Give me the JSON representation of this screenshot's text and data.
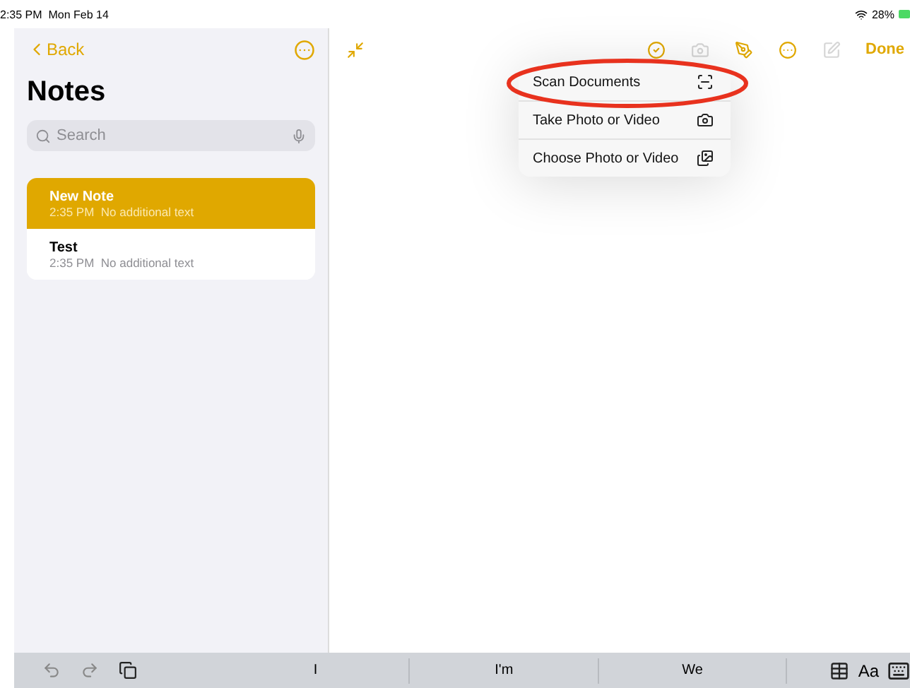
{
  "status_bar": {
    "time": "2:35 PM",
    "date": "Mon Feb 14",
    "battery": "28%"
  },
  "sidebar": {
    "back": "Back",
    "title": "Notes",
    "search": {
      "placeholder": "Search"
    },
    "notes": [
      {
        "title": "New Note",
        "time": "2:35 PM",
        "preview": "No additional text",
        "selected": true
      },
      {
        "title": "Test",
        "time": "2:35 PM",
        "preview": "No additional text",
        "selected": false
      }
    ]
  },
  "toolbar": {
    "items": [
      {
        "kind": "checklist",
        "disabled": false
      },
      {
        "kind": "camera",
        "disabled": true
      },
      {
        "kind": "markup",
        "disabled": false
      },
      {
        "kind": "more",
        "disabled": false
      },
      {
        "kind": "compose",
        "disabled": true
      }
    ],
    "done": "Done"
  },
  "menu": {
    "items": [
      {
        "label": "Scan Documents",
        "kind": "scan",
        "highlighted": true
      },
      {
        "label": "Take Photo or Video",
        "kind": "camera",
        "highlighted": false
      },
      {
        "label": "Choose Photo or Video",
        "kind": "photos",
        "highlighted": false
      }
    ]
  },
  "keyboard_bar": {
    "suggestions": [
      "I",
      "I'm",
      "We"
    ],
    "format_label": "Aa"
  }
}
